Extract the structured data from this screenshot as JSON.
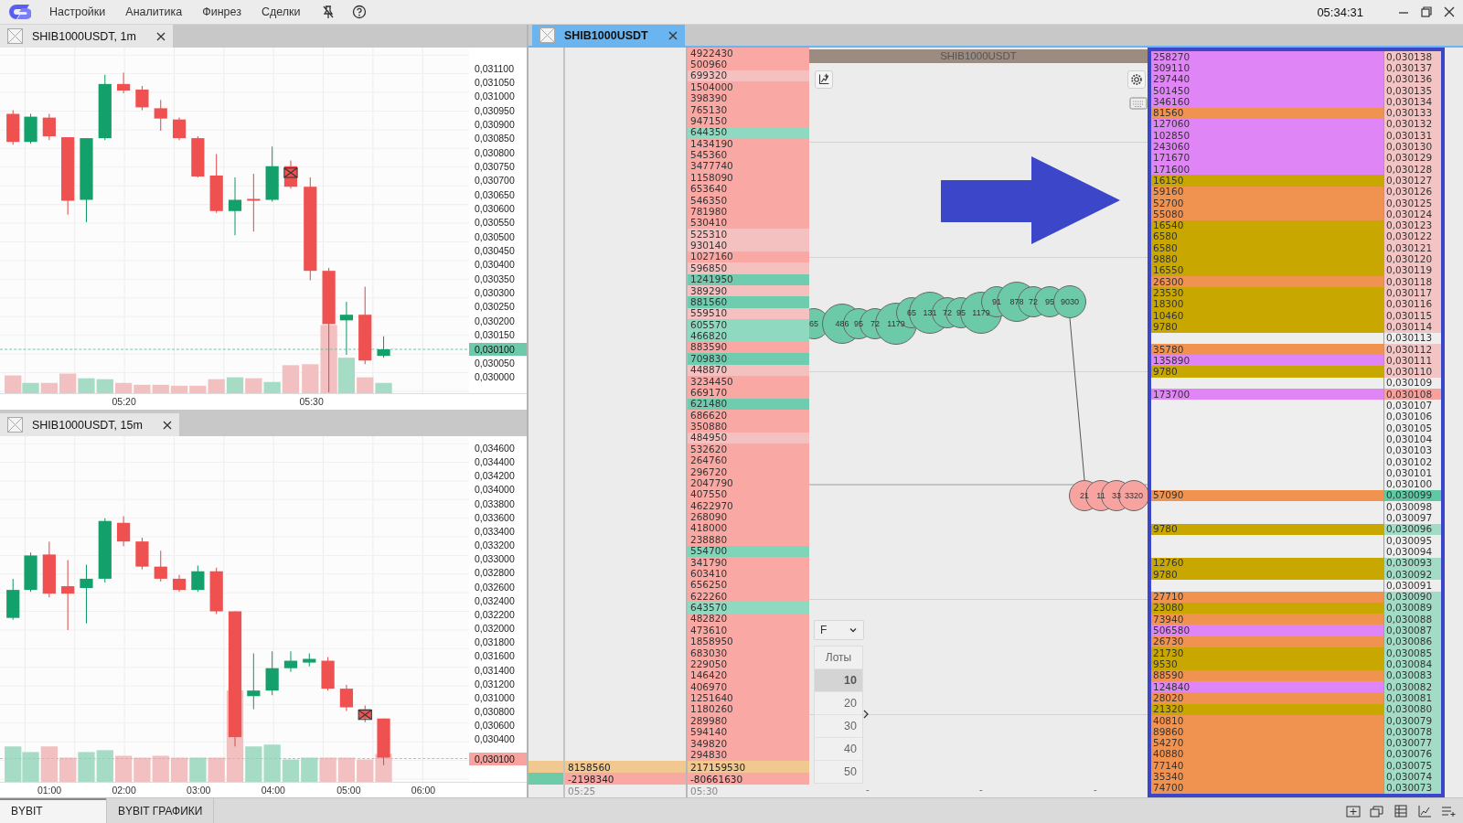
{
  "menu": {
    "items": [
      "Настройки",
      "Аналитика",
      "Финрез",
      "Сделки"
    ],
    "clock": "05:34:31"
  },
  "charts": [
    {
      "tab": "SHIB1000USDT, 1m",
      "price_labels": [
        "0,031100",
        "0,031050",
        "0,031000",
        "0,030950",
        "0,030900",
        "0,030850",
        "0,030800",
        "0,030750",
        "0,030700",
        "0,030650",
        "0,030600",
        "0,030550",
        "0,030500",
        "0,030450",
        "0,030400",
        "0,030350",
        "0,030300",
        "0,030250",
        "0,030200",
        "0,030150"
      ],
      "price_labels_below": [
        "0,030050",
        "0,030000"
      ],
      "current_price": {
        "label": "0,030100",
        "color": "#6ccaa8"
      },
      "time_labels": [
        "05:20",
        "05:30"
      ]
    },
    {
      "tab": "SHIB1000USDT, 15m",
      "price_labels": [
        "0,034600",
        "0,034400",
        "0,034200",
        "0,034000",
        "0,033800",
        "0,033600",
        "0,033400",
        "0,033200",
        "0,033000",
        "0,032800",
        "0,032600",
        "0,032400",
        "0,032200",
        "0,032000",
        "0,031800",
        "0,031600",
        "0,031400",
        "0,031200",
        "0,031000",
        "0,030800",
        "0,030600",
        "0,030400"
      ],
      "current_price": {
        "label": "0,030100",
        "color": "#f7a3a0"
      },
      "time_labels": [
        "01:00",
        "02:00",
        "03:00",
        "04:00",
        "05:00",
        "06:00"
      ]
    }
  ],
  "dom": {
    "tab": "SHIB1000USDT",
    "volumes": [
      {
        "value": "4922430",
        "color": "#f9a8a4"
      },
      {
        "value": "500960",
        "color": "#f9a8a4"
      },
      {
        "value": "699320",
        "color": "#f4c0c0"
      },
      {
        "value": "1504000",
        "color": "#f9a8a4"
      },
      {
        "value": "398390",
        "color": "#f9a8a4"
      },
      {
        "value": "765130",
        "color": "#f9a8a4"
      },
      {
        "value": "947150",
        "color": "#f9a8a4"
      },
      {
        "value": "644350",
        "color": "#8fd9c0"
      },
      {
        "value": "1434190",
        "color": "#f9a8a4"
      },
      {
        "value": "545360",
        "color": "#f9a8a4"
      },
      {
        "value": "3477740",
        "color": "#f9a8a4"
      },
      {
        "value": "1158090",
        "color": "#f9a8a4"
      },
      {
        "value": "653640",
        "color": "#f9a8a4"
      },
      {
        "value": "546350",
        "color": "#f9a8a4"
      },
      {
        "value": "781980",
        "color": "#f9a8a4"
      },
      {
        "value": "530410",
        "color": "#f9a8a4"
      },
      {
        "value": "525310",
        "color": "#f4c0c0"
      },
      {
        "value": "930140",
        "color": "#f4c0c0"
      },
      {
        "value": "1027160",
        "color": "#f9a8a4"
      },
      {
        "value": "596850",
        "color": "#f4c0c0"
      },
      {
        "value": "1241950",
        "color": "#70ccae"
      },
      {
        "value": "389290",
        "color": "#f4c0c0"
      },
      {
        "value": "881560",
        "color": "#70ccae"
      },
      {
        "value": "559510",
        "color": "#f4c0c0"
      },
      {
        "value": "605570",
        "color": "#8fd9c0"
      },
      {
        "value": "466820",
        "color": "#8fd9c0"
      },
      {
        "value": "883590",
        "color": "#f9a8a4"
      },
      {
        "value": "709830",
        "color": "#70ccae"
      },
      {
        "value": "448870",
        "color": "#f4c0c0"
      },
      {
        "value": "3234450",
        "color": "#f9a8a4"
      },
      {
        "value": "669170",
        "color": "#f9a8a4"
      },
      {
        "value": "621480",
        "color": "#70ccae"
      },
      {
        "value": "686620",
        "color": "#f9a8a4"
      },
      {
        "value": "350880",
        "color": "#f9a8a4"
      },
      {
        "value": "484950",
        "color": "#f4c0c0"
      },
      {
        "value": "532620",
        "color": "#f9a8a4"
      },
      {
        "value": "264760",
        "color": "#f9a8a4"
      },
      {
        "value": "296720",
        "color": "#f9a8a4"
      },
      {
        "value": "2047790",
        "color": "#f9a8a4"
      },
      {
        "value": "407550",
        "color": "#f9a8a4"
      },
      {
        "value": "4622970",
        "color": "#f9a8a4"
      },
      {
        "value": "268090",
        "color": "#f9a8a4"
      },
      {
        "value": "418000",
        "color": "#f9a8a4"
      },
      {
        "value": "238880",
        "color": "#f9a8a4"
      },
      {
        "value": "554700",
        "color": "#80d4b8"
      },
      {
        "value": "341790",
        "color": "#f9a8a4"
      },
      {
        "value": "603410",
        "color": "#f9a8a4"
      },
      {
        "value": "656250",
        "color": "#f9a8a4"
      },
      {
        "value": "622260",
        "color": "#f9a8a4"
      },
      {
        "value": "643570",
        "color": "#8fd9c0"
      },
      {
        "value": "482820",
        "color": "#f9a8a4"
      },
      {
        "value": "473610",
        "color": "#f9a8a4"
      },
      {
        "value": "1858950",
        "color": "#f9a8a4"
      },
      {
        "value": "683030",
        "color": "#f9a8a4"
      },
      {
        "value": "229050",
        "color": "#f9a8a4"
      },
      {
        "value": "146420",
        "color": "#f9a8a4"
      },
      {
        "value": "406970",
        "color": "#f9a8a4"
      },
      {
        "value": "1251640",
        "color": "#f9a8a4"
      },
      {
        "value": "1180260",
        "color": "#f9a8a4"
      },
      {
        "value": "289980",
        "color": "#f9a8a4"
      },
      {
        "value": "594140",
        "color": "#f9a8a4"
      },
      {
        "value": "349820",
        "color": "#f9a8a4"
      },
      {
        "value": "294830",
        "color": "#f9a8a4"
      }
    ],
    "totals": [
      {
        "color": "#f0c890",
        "cells": [
          {
            "value": "8158560",
            "color": "#f0c890"
          },
          {
            "value": "217159530",
            "color": "#f0c890"
          }
        ]
      },
      {
        "color": "#6ecba8",
        "cells": [
          {
            "value": "-2198340",
            "color": "#f9a8a4"
          },
          {
            "value": "-80661630",
            "color": "#f9a8a4"
          }
        ]
      }
    ],
    "times": [
      "05:25",
      "05:30"
    ]
  },
  "cluster": {
    "title": "SHIB1000USDT",
    "bubbles": [
      {
        "label": "65",
        "color": "#6ccaa8"
      },
      {
        "label": "486",
        "color": "#6ccaa8"
      },
      {
        "label": "95",
        "color": "#6ccaa8"
      },
      {
        "label": "72",
        "color": "#6ccaa8"
      },
      {
        "label": "1179",
        "color": "#6ccaa8"
      },
      {
        "label": "65",
        "color": "#6ccaa8"
      },
      {
        "label": "131",
        "color": "#6ccaa8"
      },
      {
        "label": "72",
        "color": "#6ccaa8"
      },
      {
        "label": "95",
        "color": "#6ccaa8"
      },
      {
        "label": "1179",
        "color": "#6ccaa8"
      },
      {
        "label": "91",
        "color": "#6ccaa8"
      },
      {
        "label": "878",
        "color": "#6ccaa8"
      },
      {
        "label": "72",
        "color": "#6ccaa8"
      },
      {
        "label": "95",
        "color": "#6ccaa8"
      },
      {
        "label": "9030",
        "color": "#6ccaa8"
      },
      {
        "label": "21",
        "color": "#f7a3a0"
      },
      {
        "label": "11",
        "color": "#f7a3a0"
      },
      {
        "label": "33",
        "color": "#f7a3a0"
      },
      {
        "label": "3320",
        "color": "#f7a3a0"
      }
    ],
    "axis_labels": [
      "-",
      "-",
      "-"
    ],
    "filter": "F",
    "lots_header": "Лоты",
    "lots": [
      {
        "label": "10",
        "selected": true
      },
      {
        "label": "20",
        "selected": false
      },
      {
        "label": "30",
        "selected": false
      },
      {
        "label": "40",
        "selected": false
      },
      {
        "label": "50",
        "selected": false
      }
    ]
  },
  "ladder": {
    "rows": [
      {
        "volume": {
          "value": "258270",
          "color": "#e085f5"
        },
        "price": {
          "value": "0,030138",
          "color": "#f2c4c4"
        }
      },
      {
        "volume": {
          "value": "309110",
          "color": "#e085f5"
        },
        "price": {
          "value": "0,030137",
          "color": "#f2c4c4"
        }
      },
      {
        "volume": {
          "value": "297440",
          "color": "#e085f5"
        },
        "price": {
          "value": "0,030136",
          "color": "#f2c4c4"
        }
      },
      {
        "volume": {
          "value": "501450",
          "color": "#e085f5"
        },
        "price": {
          "value": "0,030135",
          "color": "#f2c4c4"
        }
      },
      {
        "volume": {
          "value": "346160",
          "color": "#e085f5"
        },
        "price": {
          "value": "0,030134",
          "color": "#f2c4c4"
        }
      },
      {
        "volume": {
          "value": "81560",
          "color": "#f09350"
        },
        "price": {
          "value": "0,030133",
          "color": "#f2c4c4"
        }
      },
      {
        "volume": {
          "value": "127060",
          "color": "#e085f5"
        },
        "price": {
          "value": "0,030132",
          "color": "#f2c4c4"
        }
      },
      {
        "volume": {
          "value": "102850",
          "color": "#e085f5"
        },
        "price": {
          "value": "0,030131",
          "color": "#f2c4c4"
        }
      },
      {
        "volume": {
          "value": "243060",
          "color": "#e085f5"
        },
        "price": {
          "value": "0,030130",
          "color": "#f2c4c4"
        }
      },
      {
        "volume": {
          "value": "171670",
          "color": "#e085f5"
        },
        "price": {
          "value": "0,030129",
          "color": "#f2c4c4"
        }
      },
      {
        "volume": {
          "value": "171600",
          "color": "#e085f5"
        },
        "price": {
          "value": "0,030128",
          "color": "#f2c4c4"
        }
      },
      {
        "volume": {
          "value": "16150",
          "color": "#c8a800"
        },
        "price": {
          "value": "0,030127",
          "color": "#f2c4c4"
        }
      },
      {
        "volume": {
          "value": "59160",
          "color": "#f09350"
        },
        "price": {
          "value": "0,030126",
          "color": "#f2c4c4"
        }
      },
      {
        "volume": {
          "value": "52700",
          "color": "#f09350"
        },
        "price": {
          "value": "0,030125",
          "color": "#f2c4c4"
        }
      },
      {
        "volume": {
          "value": "55080",
          "color": "#f09350"
        },
        "price": {
          "value": "0,030124",
          "color": "#f2c4c4"
        }
      },
      {
        "volume": {
          "value": "16540",
          "color": "#c8a800"
        },
        "price": {
          "value": "0,030123",
          "color": "#f2c4c4"
        }
      },
      {
        "volume": {
          "value": "6580",
          "color": "#c8a800"
        },
        "price": {
          "value": "0,030122",
          "color": "#f2c4c4"
        }
      },
      {
        "volume": {
          "value": "6580",
          "color": "#c8a800"
        },
        "price": {
          "value": "0,030121",
          "color": "#f2c4c4"
        }
      },
      {
        "volume": {
          "value": "9880",
          "color": "#c8a800"
        },
        "price": {
          "value": "0,030120",
          "color": "#f2c4c4"
        }
      },
      {
        "volume": {
          "value": "16550",
          "color": "#c8a800"
        },
        "price": {
          "value": "0,030119",
          "color": "#f2c4c4"
        }
      },
      {
        "volume": {
          "value": "26300",
          "color": "#f09350"
        },
        "price": {
          "value": "0,030118",
          "color": "#f2c4c4"
        }
      },
      {
        "volume": {
          "value": "23530",
          "color": "#c8a800"
        },
        "price": {
          "value": "0,030117",
          "color": "#f2c4c4"
        }
      },
      {
        "volume": {
          "value": "18300",
          "color": "#c8a800"
        },
        "price": {
          "value": "0,030116",
          "color": "#f2c4c4"
        }
      },
      {
        "volume": {
          "value": "10460",
          "color": "#c8a800"
        },
        "price": {
          "value": "0,030115",
          "color": "#f2c4c4"
        }
      },
      {
        "volume": {
          "value": "9780",
          "color": "#c8a800"
        },
        "price": {
          "value": "0,030114",
          "color": "#f2c4c4"
        }
      },
      {
        "price": {
          "value": "0,030113"
        }
      },
      {
        "volume": {
          "value": "35780",
          "color": "#f09350"
        },
        "price": {
          "value": "0,030112",
          "color": "#f2c4c4"
        }
      },
      {
        "volume": {
          "value": "135890",
          "color": "#e085f5"
        },
        "price": {
          "value": "0,030111",
          "color": "#f2c4c4"
        }
      },
      {
        "volume": {
          "value": "9780",
          "color": "#c8a800"
        },
        "price": {
          "value": "0,030110",
          "color": "#f2c4c4"
        }
      },
      {
        "price": {
          "value": "0,030109"
        }
      },
      {
        "volume": {
          "value": "173700",
          "color": "#e085f5"
        },
        "price": {
          "value": "0,030108",
          "color": "#f8a09c"
        }
      },
      {
        "price": {
          "value": "0,030107"
        }
      },
      {
        "price": {
          "value": "0,030106"
        }
      },
      {
        "price": {
          "value": "0,030105"
        }
      },
      {
        "price": {
          "value": "0,030104"
        }
      },
      {
        "price": {
          "value": "0,030103"
        }
      },
      {
        "price": {
          "value": "0,030102"
        }
      },
      {
        "price": {
          "value": "0,030101"
        }
      },
      {
        "price": {
          "value": "0,030100"
        }
      },
      {
        "volume": {
          "value": "57090",
          "color": "#f09350"
        },
        "price": {
          "value": "0,030099",
          "color": "#5ec9a2"
        }
      },
      {
        "price": {
          "value": "0,030098"
        }
      },
      {
        "price": {
          "value": "0,030097"
        }
      },
      {
        "volume": {
          "value": "9780",
          "color": "#c8a800"
        },
        "price": {
          "value": "0,030096",
          "color": "#a2dcc6"
        }
      },
      {
        "price": {
          "value": "0,030095"
        }
      },
      {
        "price": {
          "value": "0,030094"
        }
      },
      {
        "volume": {
          "value": "12760",
          "color": "#c8a800"
        },
        "price": {
          "value": "0,030093",
          "color": "#a2dcc6"
        }
      },
      {
        "volume": {
          "value": "9780",
          "color": "#c8a800"
        },
        "price": {
          "value": "0,030092",
          "color": "#a2dcc6"
        }
      },
      {
        "price": {
          "value": "0,030091"
        }
      },
      {
        "volume": {
          "value": "27710",
          "color": "#f09350"
        },
        "price": {
          "value": "0,030090",
          "color": "#a2dcc6"
        }
      },
      {
        "volume": {
          "value": "23080",
          "color": "#c8a800"
        },
        "price": {
          "value": "0,030089",
          "color": "#a2dcc6"
        }
      },
      {
        "volume": {
          "value": "73940",
          "color": "#f09350"
        },
        "price": {
          "value": "0,030088",
          "color": "#a2dcc6"
        }
      },
      {
        "volume": {
          "value": "506580",
          "color": "#e085f5"
        },
        "price": {
          "value": "0,030087",
          "color": "#a2dcc6"
        }
      },
      {
        "volume": {
          "value": "26730",
          "color": "#f09350"
        },
        "price": {
          "value": "0,030086",
          "color": "#a2dcc6"
        }
      },
      {
        "volume": {
          "value": "21730",
          "color": "#c8a800"
        },
        "price": {
          "value": "0,030085",
          "color": "#a2dcc6"
        }
      },
      {
        "volume": {
          "value": "9530",
          "color": "#c8a800"
        },
        "price": {
          "value": "0,030084",
          "color": "#a2dcc6"
        }
      },
      {
        "volume": {
          "value": "88590",
          "color": "#f09350"
        },
        "price": {
          "value": "0,030083",
          "color": "#a2dcc6"
        }
      },
      {
        "volume": {
          "value": "124840",
          "color": "#e085f5"
        },
        "price": {
          "value": "0,030082",
          "color": "#a2dcc6"
        }
      },
      {
        "volume": {
          "value": "28020",
          "color": "#f09350"
        },
        "price": {
          "value": "0,030081",
          "color": "#a2dcc6"
        }
      },
      {
        "volume": {
          "value": "21320",
          "color": "#c8a800"
        },
        "price": {
          "value": "0,030080",
          "color": "#a2dcc6"
        }
      },
      {
        "volume": {
          "value": "40810",
          "color": "#f09350"
        },
        "price": {
          "value": "0,030079",
          "color": "#a2dcc6"
        }
      },
      {
        "volume": {
          "value": "89860",
          "color": "#f09350"
        },
        "price": {
          "value": "0,030078",
          "color": "#a2dcc6"
        }
      },
      {
        "volume": {
          "value": "54270",
          "color": "#f09350"
        },
        "price": {
          "value": "0,030077",
          "color": "#a2dcc6"
        }
      },
      {
        "volume": {
          "value": "40880",
          "color": "#f09350"
        },
        "price": {
          "value": "0,030076",
          "color": "#a2dcc6"
        }
      },
      {
        "volume": {
          "value": "77140",
          "color": "#f09350"
        },
        "price": {
          "value": "0,030075",
          "color": "#a2dcc6"
        }
      },
      {
        "volume": {
          "value": "35340",
          "color": "#f09350"
        },
        "price": {
          "value": "0,030074",
          "color": "#a2dcc6"
        }
      },
      {
        "volume": {
          "value": "74700",
          "color": "#f09350"
        },
        "price": {
          "value": "0,030073",
          "color": "#a2dcc6"
        }
      }
    ]
  },
  "status_bar": {
    "tabs": [
      {
        "label": "BYBIT",
        "selected": true
      },
      {
        "label": "BYBIT ГРАФИКИ",
        "selected": false
      }
    ]
  }
}
